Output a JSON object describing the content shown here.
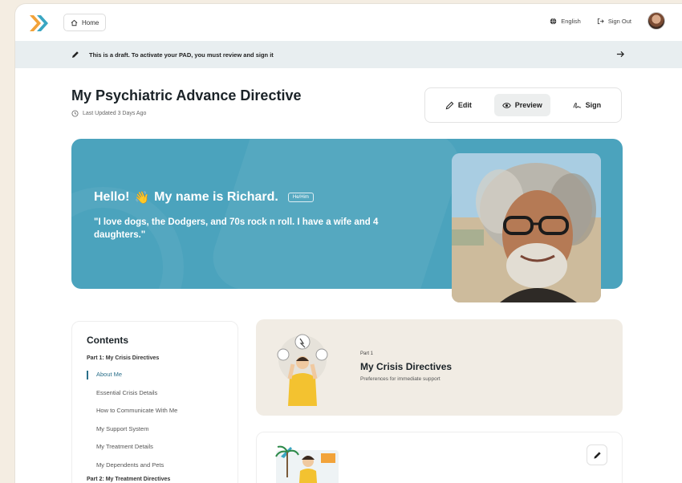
{
  "header": {
    "home_label": "Home",
    "language_label": "English",
    "signout_label": "Sign Out"
  },
  "banner": {
    "text": "This is a draft. To activate your PAD, you must review and sign it"
  },
  "page": {
    "title": "My Psychiatric Advance Directive",
    "updated": "Last Updated 3 Days Ago"
  },
  "actions": {
    "edit": "Edit",
    "preview": "Preview",
    "sign": "Sign"
  },
  "hero": {
    "greeting": "Hello!",
    "wave": "👋",
    "name_line": "My name is Richard.",
    "pronoun": "He/Him",
    "quote": "\"I love dogs, the Dodgers, and 70s rock n roll. I have a wife and 4 daughters.\""
  },
  "contents": {
    "title": "Contents",
    "part1": "Part 1: My Crisis Directives",
    "items": [
      "About Me",
      "Essential Crisis Details",
      "How to Communicate With Me",
      "My Support System",
      "My Treatment Details",
      "My Dependents and Pets"
    ],
    "part2": "Part 2: My Treatment Directives"
  },
  "part_card": {
    "label": "Part 1",
    "title": "My Crisis Directives",
    "subtitle": "Preferences for immediate support"
  },
  "colors": {
    "hero_bg": "#4ba3bd",
    "banner_bg": "#e8eef0",
    "accent": "#2a6f8a"
  }
}
